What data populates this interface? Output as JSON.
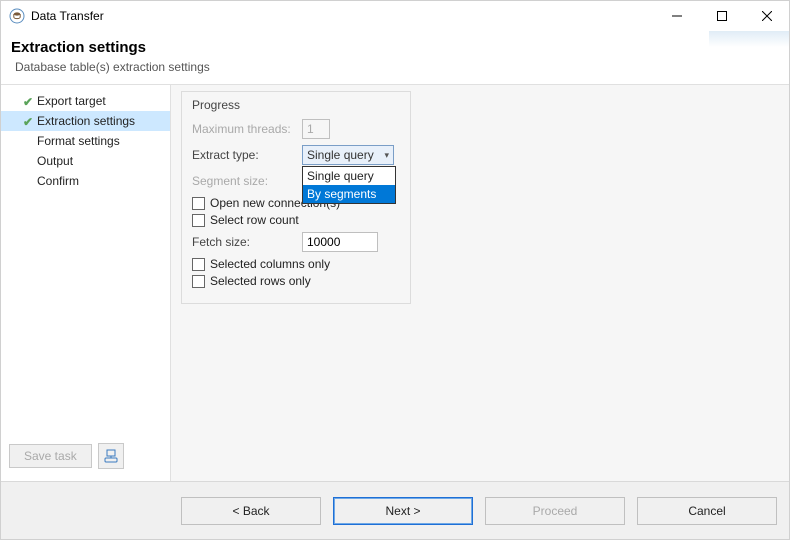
{
  "window": {
    "title": "Data Transfer"
  },
  "header": {
    "title": "Extraction settings",
    "subtitle": "Database table(s) extraction settings"
  },
  "sidebar": {
    "items": [
      {
        "label": "Export target",
        "done": true,
        "active": false
      },
      {
        "label": "Extraction settings",
        "done": true,
        "active": true
      },
      {
        "label": "Format settings",
        "done": false,
        "active": false
      },
      {
        "label": "Output",
        "done": false,
        "active": false
      },
      {
        "label": "Confirm",
        "done": false,
        "active": false
      }
    ],
    "save_task_label": "Save task"
  },
  "progress": {
    "group_title": "Progress",
    "max_threads_label": "Maximum threads:",
    "max_threads_value": "1",
    "extract_type_label": "Extract type:",
    "extract_type_selected": "Single query",
    "extract_type_options": [
      {
        "label": "Single query",
        "highlight": false
      },
      {
        "label": "By segments",
        "highlight": true
      }
    ],
    "segment_size_label": "Segment size:",
    "open_new_conn_label": "Open new connection(s)",
    "select_row_count_label": "Select row count",
    "fetch_size_label": "Fetch size:",
    "fetch_size_value": "10000",
    "selected_cols_label": "Selected columns only",
    "selected_rows_label": "Selected rows only"
  },
  "footer": {
    "back_label": "< Back",
    "next_label": "Next >",
    "proceed_label": "Proceed",
    "cancel_label": "Cancel"
  }
}
